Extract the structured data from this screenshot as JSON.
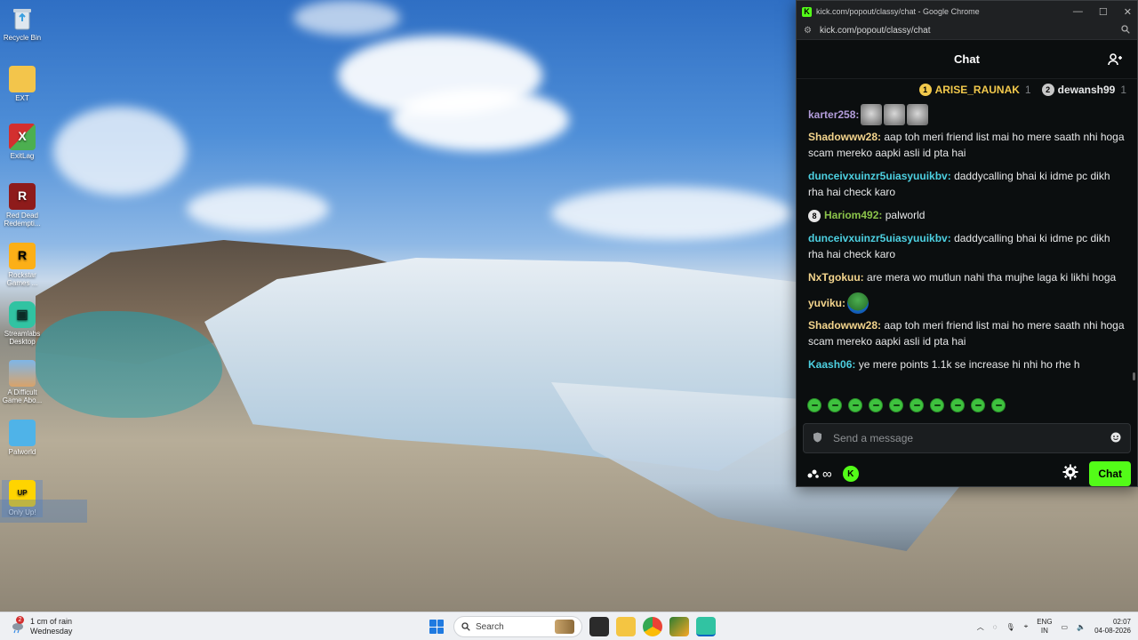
{
  "desktop": {
    "icons": [
      {
        "label": "Recycle Bin"
      },
      {
        "label": "EXT"
      },
      {
        "label": "ExitLag"
      },
      {
        "label": "Red Dead Redempti..."
      },
      {
        "label": "Rockstar Games ..."
      },
      {
        "label": "Streamlabs Desktop"
      },
      {
        "label": "A Difficult Game Abo..."
      },
      {
        "label": "Palworld"
      },
      {
        "label": "Only Up!"
      }
    ]
  },
  "browser": {
    "window_title": "kick.com/popout/classy/chat - Google Chrome",
    "logo_letter": "K",
    "url": "kick.com/popout/classy/chat",
    "controls": {
      "minimize": "—",
      "maximize": "☐",
      "close": "✕"
    }
  },
  "chat": {
    "header_title": "Chat",
    "leaderboard": [
      {
        "rank": "1",
        "name": "ARISE_RAUNAK",
        "count": "1",
        "color": "#f2c94c",
        "badge_color": "#f2c94c"
      },
      {
        "rank": "2",
        "name": "dewansh99",
        "count": "1",
        "color": "#e6e7e8",
        "badge_color": "#c8c8c8"
      }
    ],
    "messages": [
      {
        "user": "karter258",
        "text": "",
        "color": "#b39ddb",
        "emotes": [
          "cat",
          "cat",
          "cat"
        ]
      },
      {
        "user": "Shadowww28",
        "text": "aap toh meri friend list mai ho mere saath nhi hoga scam mereko aapki asli id pta hai",
        "color": "#f4d58d"
      },
      {
        "user": "dunceivxuinzr5uiasyuuikbv",
        "text": "daddycalling bhai ki idme pc dikh rha hai check karo",
        "color": "#4dd0e1"
      },
      {
        "user": "Hariom492",
        "text": "palworld",
        "color": "#8bc34a",
        "badge": "8"
      },
      {
        "user": "dunceivxuinzr5uiasyuuikbv",
        "text": "daddycalling bhai ki idme pc dikh rha hai check karo",
        "color": "#4dd0e1"
      },
      {
        "user": "NxTgokuu",
        "text": "are mera wo mutlun nahi tha mujhe laga ki likhi hoga",
        "color": "#f4d58d"
      },
      {
        "user": "yuviku",
        "text": "",
        "color": "#f4d58d",
        "emotes": [
          "pepe"
        ]
      },
      {
        "user": "Shadowww28",
        "text": "aap toh meri friend list mai ho mere saath nhi hoga scam mereko aapki asli id pta hai",
        "color": "#f4d58d"
      },
      {
        "user": "Kaash06",
        "text": "ye mere points 1.1k se increase hi nhi ho rhe h",
        "color": "#4dd0e1"
      }
    ],
    "emote_bar_count": 10,
    "input_placeholder": "Send a message",
    "send_button": "Chat",
    "accent": "#53fc18",
    "infinity_symbol": "∞"
  },
  "taskbar": {
    "weather_line1": "1 cm of rain",
    "weather_line2": "Wednesday",
    "weather_badge": "2",
    "search_placeholder": "Search",
    "lang_line1": "ENG",
    "lang_line2": "IN",
    "time": "02:07",
    "date": "04-08-2026"
  }
}
